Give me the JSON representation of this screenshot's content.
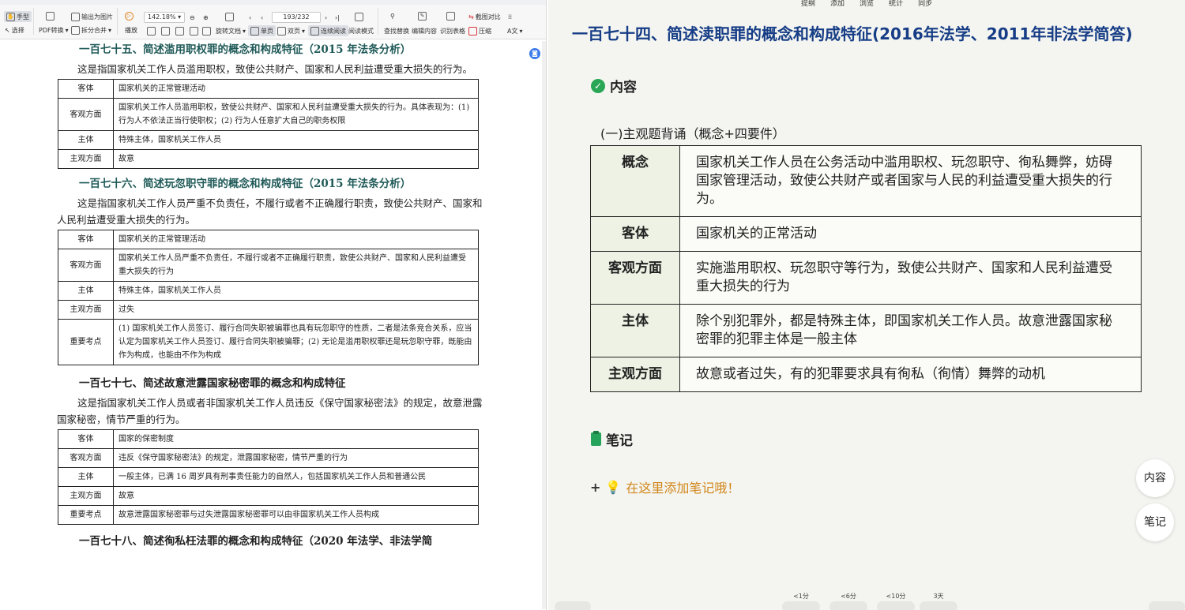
{
  "toolbar": {
    "hand": "手型",
    "select": "选择",
    "pdf_convert": "PDF转换",
    "export_image": "输出为图片",
    "split_merge": "拆分合并",
    "play": "播放",
    "zoom": "142.18%",
    "page": "193/232",
    "rotate": "旋转文档",
    "single": "单页",
    "double": "双页",
    "continuous": "连续阅读",
    "read_mode": "阅读模式",
    "find": "查找替换",
    "edit": "编辑内容",
    "recognize": "识别表格",
    "compare": "截图对比",
    "compress": "压缩",
    "translate": "A文"
  },
  "pdf": {
    "s175": {
      "title": "一百七十五、简述滥用职权罪的概念和构成特征（2015 年法条分析）",
      "para": "这是指国家机关工作人员滥用职权，致使公共财产、国家和人民利益遭受重大损失的行为。",
      "rows": [
        {
          "k": "客体",
          "v": "国家机关的正常管理活动"
        },
        {
          "k": "客观方面",
          "v": "国家机关工作人员滥用职权，致使公共财产、国家和人民利益遭受重大损失的行为。具体表现为：(1) 行为人不依法正当行使职权；(2) 行为人任意扩大自己的职务权限"
        },
        {
          "k": "主体",
          "v": "特殊主体，国家机关工作人员"
        },
        {
          "k": "主观方面",
          "v": "故意"
        }
      ]
    },
    "s176": {
      "title": "一百七十六、简述玩忽职守罪的概念和构成特征（2015 年法条分析）",
      "para": "这是指国家机关工作人员严重不负责任，不履行或者不正确履行职责，致使公共财产、国家和人民利益遭受重大损失的行为。",
      "rows": [
        {
          "k": "客体",
          "v": "国家机关的正常管理活动"
        },
        {
          "k": "客观方面",
          "v": "国家机关工作人员严重不负责任，不履行或者不正确履行职责，致使公共财产、国家和人民利益遭受重大损失的行为"
        },
        {
          "k": "主体",
          "v": "特殊主体，国家机关工作人员"
        },
        {
          "k": "主观方面",
          "v": "过失"
        },
        {
          "k": "重要考点",
          "v": "(1) 国家机关工作人员签订、履行合同失职被骗罪也具有玩忽职守的性质，二者是法条竞合关系，应当认定为国家机关工作人员签订、履行合同失职被骗罪；(2) 无论是滥用职权罪还是玩忽职守罪，既能由作为构成，也能由不作为构成"
        }
      ]
    },
    "s177": {
      "title": "一百七十七、简述故意泄露国家秘密罪的概念和构成特征",
      "para": "这是指国家机关工作人员或者非国家机关工作人员违反《保守国家秘密法》的规定，故意泄露国家秘密，情节严重的行为。",
      "rows": [
        {
          "k": "客体",
          "v": "国家的保密制度"
        },
        {
          "k": "客观方面",
          "v": "违反《保守国家秘密法》的规定，泄露国家秘密，情节严重的行为"
        },
        {
          "k": "主体",
          "v": "一般主体，已满 16 周岁具有刑事责任能力的自然人，包括国家机关工作人员和普通公民"
        },
        {
          "k": "主观方面",
          "v": "故意"
        },
        {
          "k": "重要考点",
          "v": "故意泄露国家秘密罪与过失泄露国家秘密罪可以由非国家机关工作人员构成"
        }
      ]
    },
    "s178_title": "一百七十八、简述徇私枉法罪的概念和构成特征（2020 年法学、非法学简"
  },
  "note": {
    "menu": [
      "提纲",
      "添加",
      "浏览",
      "统计",
      "同步"
    ],
    "title": "一百七十四、简述渎职罪的概念和构成特征(2016年法学、2011年非法学简答)",
    "content_label": "内容",
    "sub": "(一)主观题背诵（概念+四要件）",
    "rows": [
      {
        "k": "概念",
        "v": "国家机关工作人员在公务活动中滥用职权、玩忽职守、徇私舞弊，妨碍国家管理活动，致使公共财产或者国家与人民的利益遭受重大损失的行为。"
      },
      {
        "k": "客体",
        "v": "国家机关的正常活动"
      },
      {
        "k": "客观方面",
        "v": "实施滥用职权、玩忽职守等行为，致使公共财产、国家和人民利益遭受重大损失的行为"
      },
      {
        "k": "主体",
        "v": "除个别犯罪外，都是特殊主体，即国家机关工作人员。故意泄露国家秘密罪的犯罪主体是一般主体"
      },
      {
        "k": "主观方面",
        "v": "故意或者过失，有的犯罪要求具有徇私（徇情）舞弊的动机"
      }
    ],
    "notes_label": "笔记",
    "add_note": "在这里添加笔记哦！",
    "side_content": "内容",
    "side_notes": "笔记",
    "rates": [
      "<1分",
      "<6分",
      "<10分",
      "3天"
    ]
  }
}
